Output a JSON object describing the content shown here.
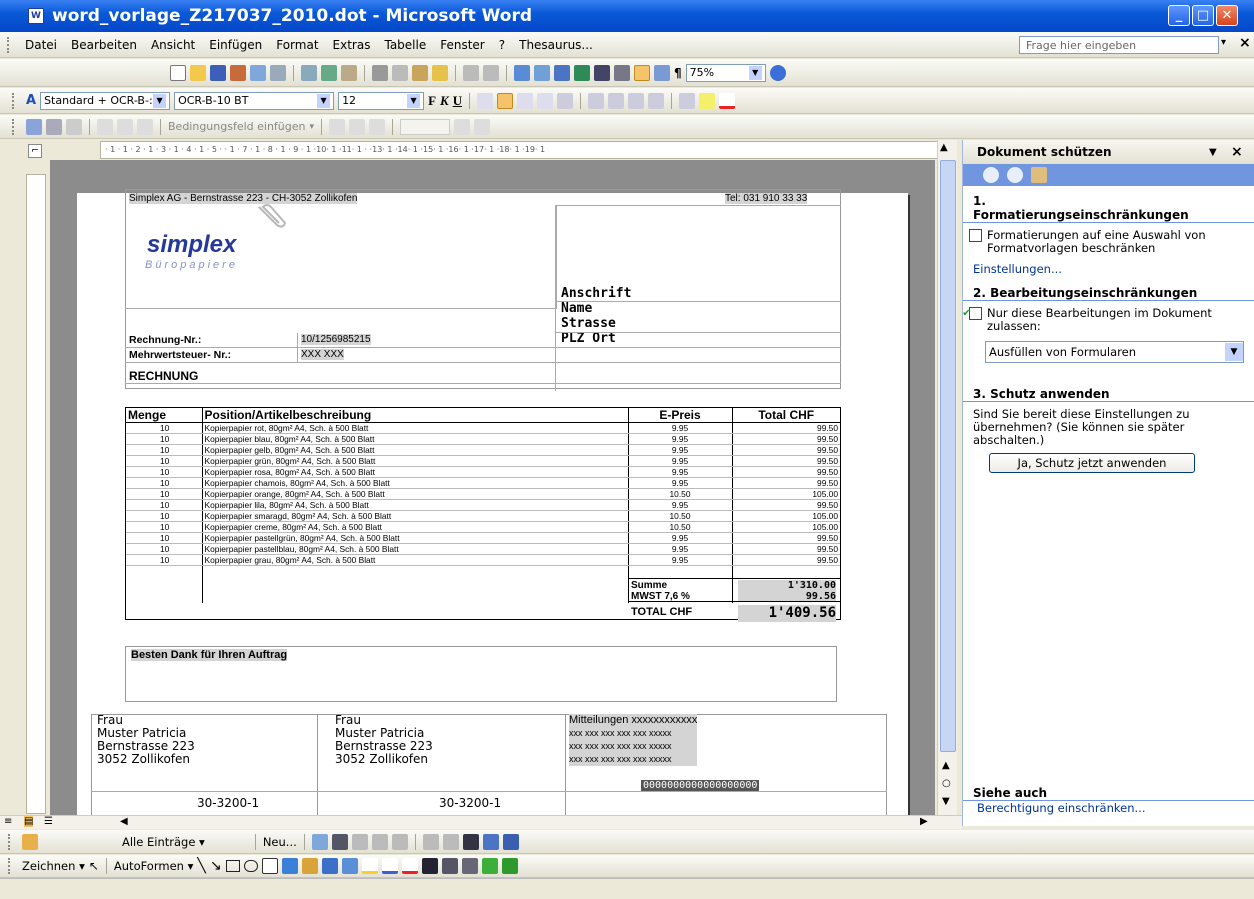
{
  "window": {
    "title": "word_vorlage_Z217037_2010.dot - Microsoft Word",
    "minimize": "_",
    "maximize": "□",
    "close": "✕"
  },
  "menu": {
    "items": [
      "Datei",
      "Bearbeiten",
      "Ansicht",
      "Einfügen",
      "Format",
      "Extras",
      "Tabelle",
      "Fenster",
      "?",
      "Thesaurus..."
    ],
    "help_placeholder": "Frage hier eingeben",
    "close_doc": "×"
  },
  "format_bar": {
    "style": "Standard + OCR-B-:",
    "font": "OCR-B-10 BT",
    "size": "12",
    "zoom": "75%",
    "para_mark": "¶"
  },
  "forms_bar": {
    "condition_button": "Bedingungsfeld einfügen"
  },
  "ruler": {
    "h_labels": "· 1 · 1 · 2 · 1 · 3 · 1 · 4 · 1 · 5 ·  · 1 · 7 · 1 · 8 · 1 · 9 · 1 ·10· 1 ·11· 1 ·  ·13· 1 ·14· 1 ·15· 1 ·16· 1 ·17· 1 ·18· 1 ·19· 1"
  },
  "invoice": {
    "sender_line": "Simplex AG - Bernstrasse 223 - CH-3052 Zollikofen",
    "tel": "Tel: 031 910 33 33",
    "logo_word": "simplex",
    "logo_sub": "Büropapiere",
    "address": [
      "Anschrift",
      "Name",
      "Strasse",
      "PLZ Ort"
    ],
    "invoice_no_label": "Rechnung-Nr.:",
    "invoice_no": "10/1256985215",
    "vat_label": "Mehrwertsteuer- Nr.:",
    "vat_no": "XXX XXX",
    "heading": "RECHNUNG",
    "columns": [
      "Menge",
      "Position/Artikelbeschreibung",
      "E-Preis",
      "Total CHF"
    ],
    "rows": [
      [
        "10",
        "Kopierpapier rot, 80gm² A4, Sch. à 500 Blatt",
        "9.95",
        "99.50"
      ],
      [
        "10",
        "Kopierpapier blau, 80gm² A4, Sch. à 500 Blatt",
        "9.95",
        "99.50"
      ],
      [
        "10",
        "Kopierpapier gelb, 80gm² A4, Sch. à 500 Blatt",
        "9.95",
        "99.50"
      ],
      [
        "10",
        "Kopierpapier grün, 80gm² A4, Sch. à 500 Blatt",
        "9.95",
        "99.50"
      ],
      [
        "10",
        "Kopierpapier rosa, 80gm² A4, Sch. à 500 Blatt",
        "9.95",
        "99.50"
      ],
      [
        "10",
        "Kopierpapier chamois, 80gm² A4, Sch. à 500 Blatt",
        "9.95",
        "99.50"
      ],
      [
        "10",
        "Kopierpapier orange, 80gm² A4, Sch. à 500 Blatt",
        "10.50",
        "105.00"
      ],
      [
        "10",
        "Kopierpapier lila, 80gm² A4, Sch. à 500 Blatt",
        "9.95",
        "99.50"
      ],
      [
        "10",
        "Kopierpapier smaragd, 80gm² A4, Sch. à 500 Blatt",
        "10.50",
        "105.00"
      ],
      [
        "10",
        "Kopierpapier creme, 80gm² A4, Sch. à 500 Blatt",
        "10.50",
        "105.00"
      ],
      [
        "10",
        "Kopierpapier pastellgrün, 80gm² A4, Sch. à 500 Blatt",
        "9.95",
        "99.50"
      ],
      [
        "10",
        "Kopierpapier pastellblau, 80gm² A4, Sch. à 500 Blatt",
        "9.95",
        "99.50"
      ],
      [
        "10",
        "Kopierpapier grau, 80gm² A4, Sch. à 500 Blatt",
        "9.95",
        "99.50"
      ]
    ],
    "sum_label": "Summe",
    "sum": "1'310.00",
    "mwst_label": "MWST 7,6 %",
    "mwst": "99.56",
    "total_label": "TOTAL CHF",
    "total": "1'409.56",
    "thanks": "Besten Dank für Ihren Auftrag",
    "slip_left": [
      "Frau",
      "Muster Patricia",
      "Bernstrasse  223",
      "3052 Zollikofen"
    ],
    "slip_mid": [
      "Frau",
      "Muster Patricia",
      "Bernstrasse  223",
      "3052 Zollikofen"
    ],
    "slip_msg": [
      "Mitteilungen xxxxxxxxxxxx",
      "xxx xxx xxx xxx xxx xxxxx",
      "xxx xxx xxx xxx xxx xxxxx",
      "xxx xxx xxx xxx xxx xxxxx"
    ],
    "slip_ref": "0000000000000000000",
    "slip_acct": "30-3200-1"
  },
  "task_pane": {
    "title": "Dokument schützen",
    "s1_num": "1.",
    "s1_title": "Formatierungseinschränkungen",
    "s1_check": "Formatierungen auf eine Auswahl von Formatvorlagen beschränken",
    "s1_link": "Einstellungen...",
    "s2_title": "2. Bearbeitungseinschränkungen",
    "s2_check": "Nur diese Bearbeitungen im Dokument zulassen:",
    "s2_select": "Ausfüllen von Formularen",
    "s3_title": "3. Schutz anwenden",
    "s3_text": "Sind Sie bereit diese Einstellungen zu übernehmen? (Sie können sie später abschalten.)",
    "s3_button": "Ja, Schutz jetzt anwenden",
    "see_also": "Siehe auch",
    "see_also_link": "Berechtigung einschränken..."
  },
  "mail_merge_bar": {
    "entries": "Alle Einträge ▾",
    "new": "Neu..."
  },
  "drawing_bar": {
    "draw": "Zeichnen ▾",
    "autoshapes": "AutoFormen ▾"
  }
}
